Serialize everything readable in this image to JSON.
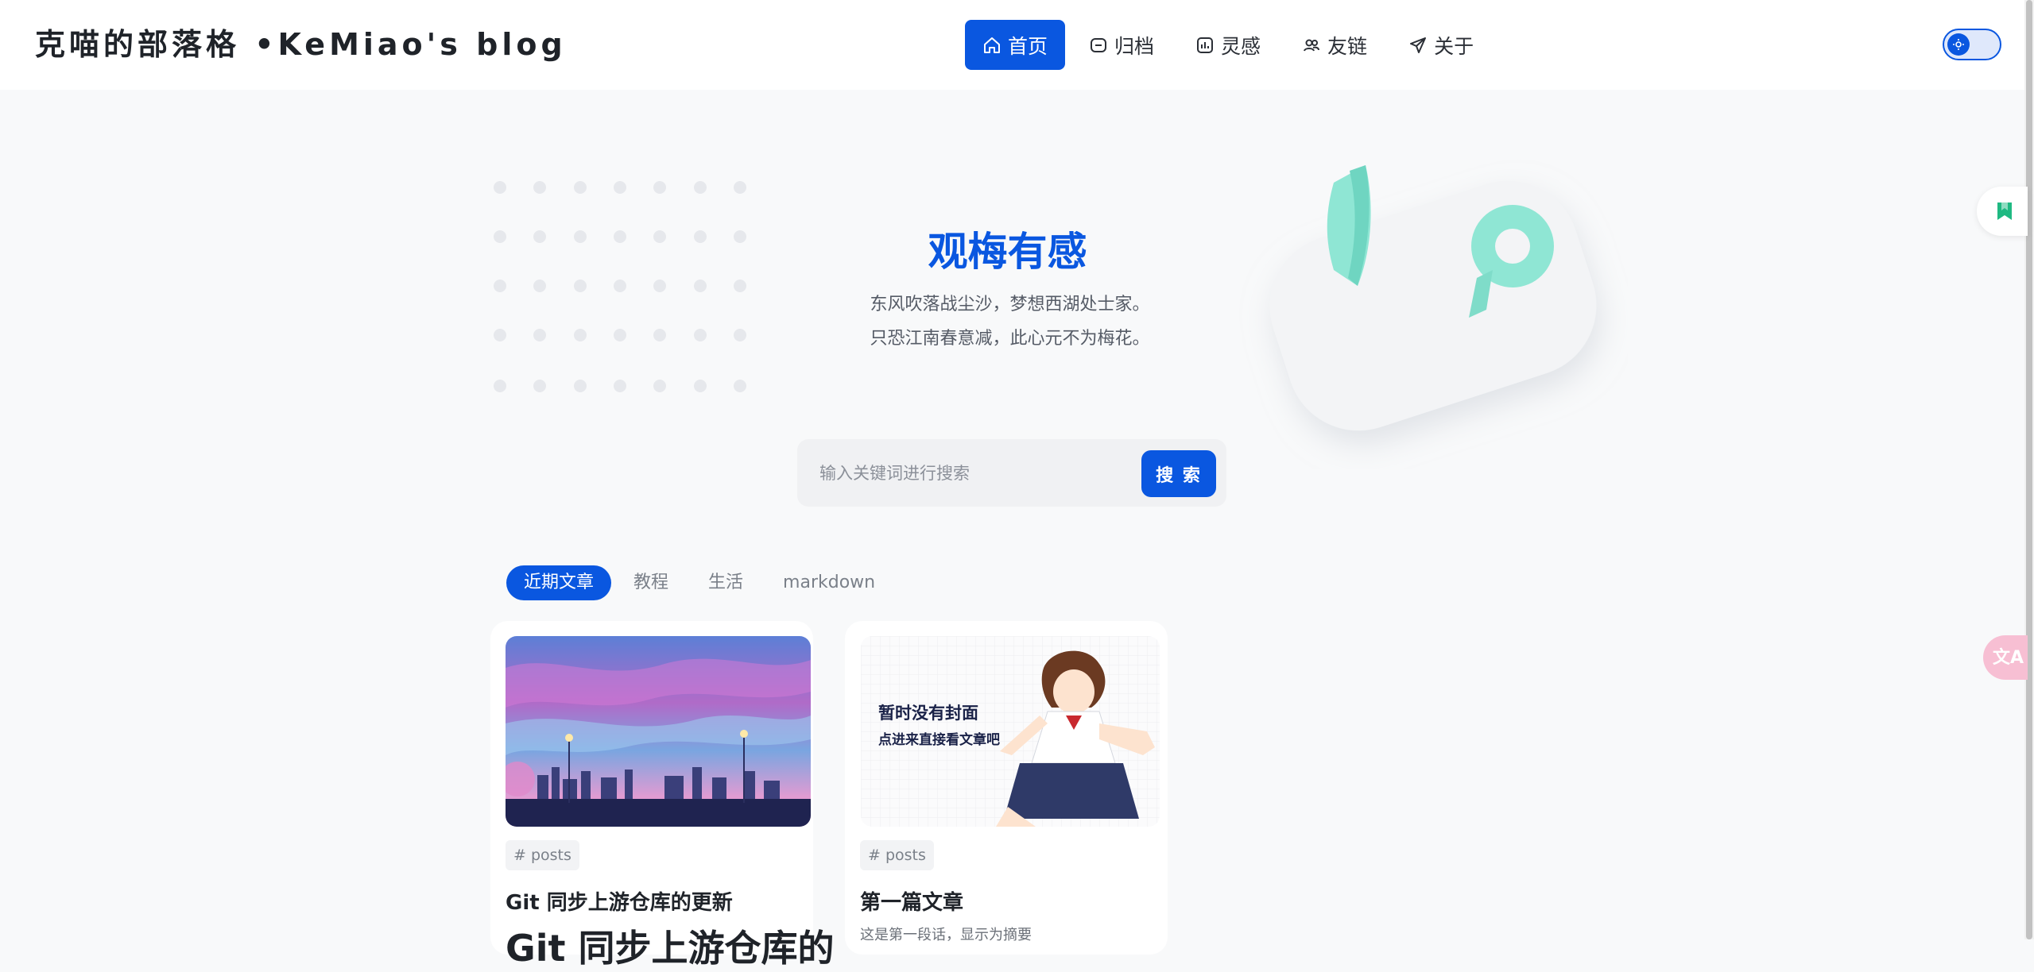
{
  "brand": {
    "title": "克喵的部落格 •KeMiao's blog"
  },
  "nav": {
    "items": [
      {
        "label": "首页",
        "icon": "home-icon",
        "active": true
      },
      {
        "label": "归档",
        "icon": "archive-icon",
        "active": false
      },
      {
        "label": "灵感",
        "icon": "chart-icon",
        "active": false
      },
      {
        "label": "友链",
        "icon": "friends-icon",
        "active": false
      },
      {
        "label": "关于",
        "icon": "send-icon",
        "active": false
      }
    ]
  },
  "theme_toggle": {
    "icon": "sun-icon"
  },
  "hero": {
    "title": "观梅有感",
    "lines": [
      "东风吹落战尘沙，梦想西湖处士家。",
      "只恐江南春意减，此心元不为梅花。"
    ]
  },
  "search": {
    "placeholder": "输入关键词进行搜索",
    "button_label": "搜 索"
  },
  "tabs": [
    {
      "label": "近期文章",
      "active": true
    },
    {
      "label": "教程",
      "active": false
    },
    {
      "label": "生活",
      "active": false
    },
    {
      "label": "markdown",
      "active": false
    }
  ],
  "cards": [
    {
      "tag": "# posts",
      "title": "Git 同步上游仓库的更新",
      "big_title": "Git 同步上游仓库的",
      "cover": "anime-cityscape-sky"
    },
    {
      "tag": "# posts",
      "title": "第一篇文章",
      "excerpt": "这是第一段话，显示为摘要",
      "cover_text_1": "暂时没有封面",
      "cover_text_2": "点进来直接看文章吧",
      "cover": "anime-girl-placeholder"
    }
  ],
  "side": {
    "bookmark_icon": "bookmark-icon",
    "translate_icon": "translate-icon",
    "translate_glyph": "文A"
  },
  "colors": {
    "accent": "#0a57e0",
    "mint": "#7fe3cf",
    "pink": "#f7bfd3"
  }
}
